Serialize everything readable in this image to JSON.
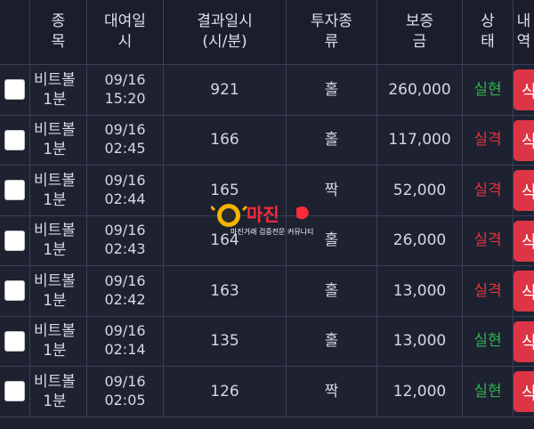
{
  "headers": [
    "",
    "종\n목",
    "대여일\n시",
    "결과일시\n(시/분)",
    "투자종\n류",
    "보증\n금",
    "상\n태",
    "내\n역"
  ],
  "rows": [
    {
      "symbol": "비트볼\n1분",
      "date": "09/16\n15:20",
      "result": "921",
      "type": "홀",
      "amount": "260,000",
      "status": "실현",
      "status_kind": "win"
    },
    {
      "symbol": "비트볼\n1분",
      "date": "09/16\n02:45",
      "result": "166",
      "type": "홀",
      "amount": "117,000",
      "status": "실격",
      "status_kind": "lose"
    },
    {
      "symbol": "비트볼\n1분",
      "date": "09/16\n02:44",
      "result": "165",
      "type": "짝",
      "amount": "52,000",
      "status": "실격",
      "status_kind": "lose"
    },
    {
      "symbol": "비트볼\n1분",
      "date": "09/16\n02:43",
      "result": "164",
      "type": "홀",
      "amount": "26,000",
      "status": "실격",
      "status_kind": "lose"
    },
    {
      "symbol": "비트볼\n1분",
      "date": "09/16\n02:42",
      "result": "163",
      "type": "홀",
      "amount": "13,000",
      "status": "실격",
      "status_kind": "lose"
    },
    {
      "symbol": "비트볼\n1분",
      "date": "09/16\n02:14",
      "result": "135",
      "type": "홀",
      "amount": "13,000",
      "status": "실현",
      "status_kind": "win"
    },
    {
      "symbol": "비트볼\n1분",
      "date": "09/16\n02:05",
      "result": "126",
      "type": "짝",
      "amount": "12,000",
      "status": "실현",
      "status_kind": "win"
    }
  ],
  "delete_label": "삭제",
  "watermark": {
    "title": "마진",
    "subtitle": "마진거래 검증전문 커뮤니티"
  },
  "colors": {
    "win": "#2fb34e",
    "lose": "#e23340",
    "button": "#dd3545"
  }
}
